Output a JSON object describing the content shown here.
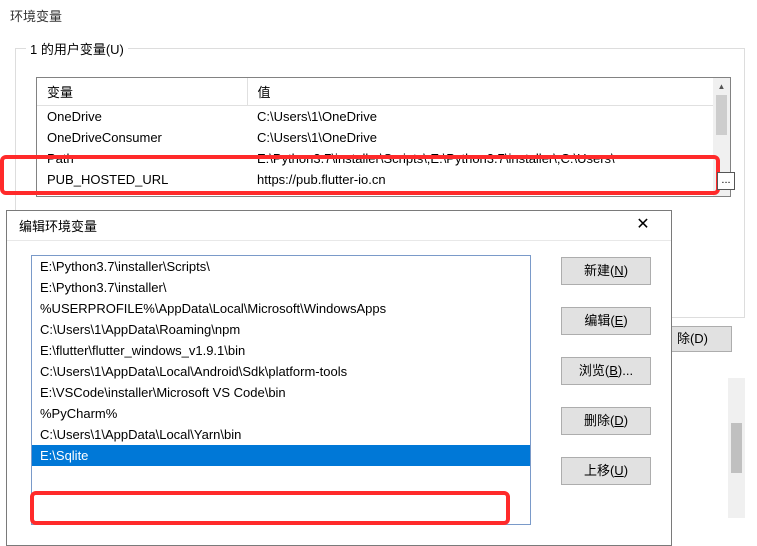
{
  "window": {
    "title": "环境变量"
  },
  "userGroup": {
    "label": "1 的用户变量(U)"
  },
  "varTable": {
    "headers": [
      "变量",
      "值"
    ],
    "rows": [
      {
        "name": "OneDrive",
        "value": "C:\\Users\\1\\OneDrive"
      },
      {
        "name": "OneDriveConsumer",
        "value": "C:\\Users\\1\\OneDrive"
      },
      {
        "name": "Path",
        "value": "E:\\Python3.7\\installer\\Scripts\\;E:\\Python3.7\\installer\\;C:\\Users\\"
      },
      {
        "name": "PUB_HOSTED_URL",
        "value": "https://pub.flutter-io.cn"
      }
    ]
  },
  "ellipsis": "...",
  "bgButtons": {
    "delete": "除(D)"
  },
  "editDialog": {
    "title": "编辑环境变量",
    "paths": [
      "E:\\Python3.7\\installer\\Scripts\\",
      "E:\\Python3.7\\installer\\",
      "%USERPROFILE%\\AppData\\Local\\Microsoft\\WindowsApps",
      "C:\\Users\\1\\AppData\\Roaming\\npm",
      "E:\\flutter\\flutter_windows_v1.9.1\\bin",
      "C:\\Users\\1\\AppData\\Local\\Android\\Sdk\\platform-tools",
      "E:\\VSCode\\installer\\Microsoft VS Code\\bin",
      "%PyCharm%",
      "C:\\Users\\1\\AppData\\Local\\Yarn\\bin",
      "E:\\Sqlite"
    ],
    "selectedIndex": 9,
    "buttons": {
      "new_pre": "新建(",
      "new_u": "N",
      "new_post": ")",
      "edit_pre": "编辑(",
      "edit_u": "E",
      "edit_post": ")",
      "browse_pre": "浏览(",
      "browse_u": "B",
      "browse_post": ")...",
      "delete_pre": "删除(",
      "delete_u": "D",
      "delete_post": ")",
      "moveup_pre": "上移(",
      "moveup_u": "U",
      "moveup_post": ")"
    }
  }
}
